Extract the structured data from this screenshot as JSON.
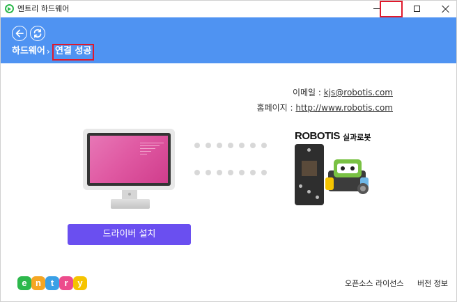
{
  "window": {
    "title": "엔트리 하드웨어"
  },
  "header": {
    "breadcrumb_root": "하드웨어",
    "breadcrumb_separator": "›",
    "breadcrumb_current": "연결 성공"
  },
  "contact": {
    "email_label": "이메일 : ",
    "email_value": "kjs@robotis.com",
    "homepage_label": "홈페이지 : ",
    "homepage_value": "http://www.robotis.com"
  },
  "device": {
    "brand": "ROBOTIS",
    "product": "실과로봇"
  },
  "actions": {
    "driver_install_label": "드라이버 설치"
  },
  "footer": {
    "logo_letters": [
      "e",
      "n",
      "t",
      "r",
      "y"
    ],
    "license_label": "오픈소스 라이선스",
    "version_label": "버전 정보"
  },
  "colors": {
    "header_bg": "#4f93f2",
    "button_bg": "#6a4ff0",
    "highlight": "#e0192c",
    "logo": [
      "#2db84c",
      "#f5a623",
      "#3aa0e6",
      "#ec4c8c",
      "#f6c400"
    ]
  },
  "icons": {
    "back": "back-arrow-icon",
    "refresh": "refresh-icon",
    "app": "entry-app-icon"
  }
}
